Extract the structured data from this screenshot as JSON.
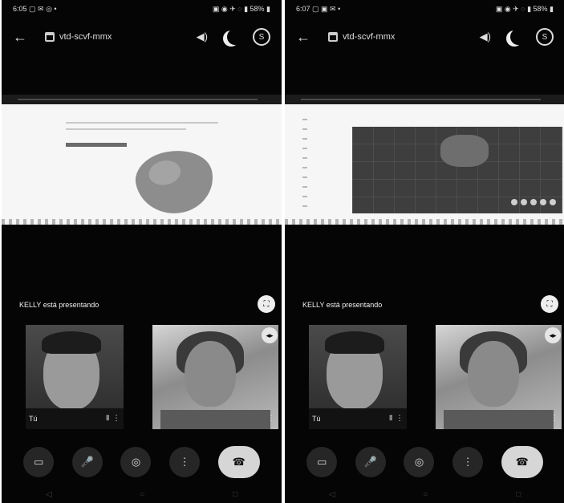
{
  "left": {
    "status_time": "6:05 ▢ ✉ ◎ •",
    "status_icons": "▣ ◉ ✈ ◌ ▮ 58% ▮",
    "meet_code": "vtd-scvf-mmx",
    "presenting": "KELLY está presentando",
    "tiles": [
      {
        "name": "Tú",
        "mic": "⫴",
        "more": "⋮"
      },
      {
        "name": "",
        "mic": "",
        "more": "⋮"
      }
    ]
  },
  "right": {
    "status_time": "6:07 ▢ ▣ ✉ •",
    "status_icons": "▣ ◉ ✈ ◌ ▮ 58% ▮",
    "meet_code": "vtd-scvf-mmx",
    "presenting": "KELLY está presentando",
    "tiles": [
      {
        "name": "Tú",
        "mic": "⫴",
        "more": "⋮"
      },
      {
        "name": "",
        "mic": "",
        "more": "⋮"
      }
    ]
  },
  "icons": {
    "back": "←",
    "speaker": "◀)",
    "sync": "S",
    "fullscreen": "⛶",
    "audio": "◂▸",
    "camera": "▭",
    "mic": "🎤",
    "present": "◎",
    "more": "⋮",
    "end_call": "☎",
    "nav": [
      "◁",
      "○",
      "□"
    ]
  }
}
